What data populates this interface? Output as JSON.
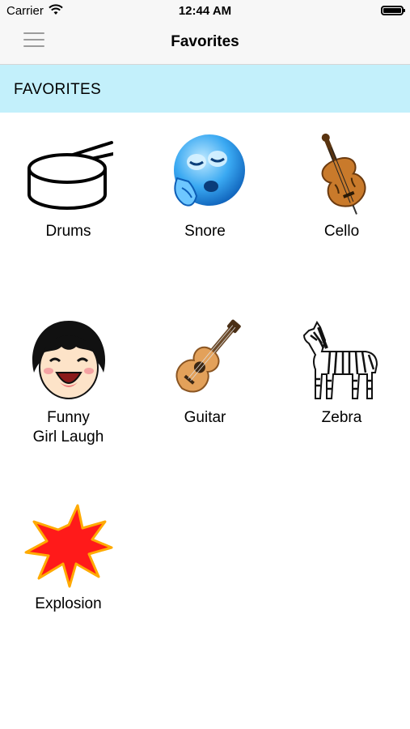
{
  "status_bar": {
    "carrier": "Carrier",
    "time": "12:44 AM"
  },
  "nav": {
    "title": "Favorites",
    "menu_icon": "hamburger-menu-icon"
  },
  "section": {
    "title": "FAVORITES",
    "color": "#c3f0fb"
  },
  "favorites": [
    {
      "label": "Drums",
      "icon": "drum-icon"
    },
    {
      "label": "Snore",
      "icon": "snore-emoji-icon"
    },
    {
      "label": "Cello",
      "icon": "cello-icon"
    },
    {
      "label": "Funny\nGirl Laugh",
      "icon": "laughing-girl-icon"
    },
    {
      "label": "Guitar",
      "icon": "guitar-icon"
    },
    {
      "label": "Zebra",
      "icon": "zebra-icon"
    },
    {
      "label": "Explosion",
      "icon": "explosion-icon"
    }
  ]
}
